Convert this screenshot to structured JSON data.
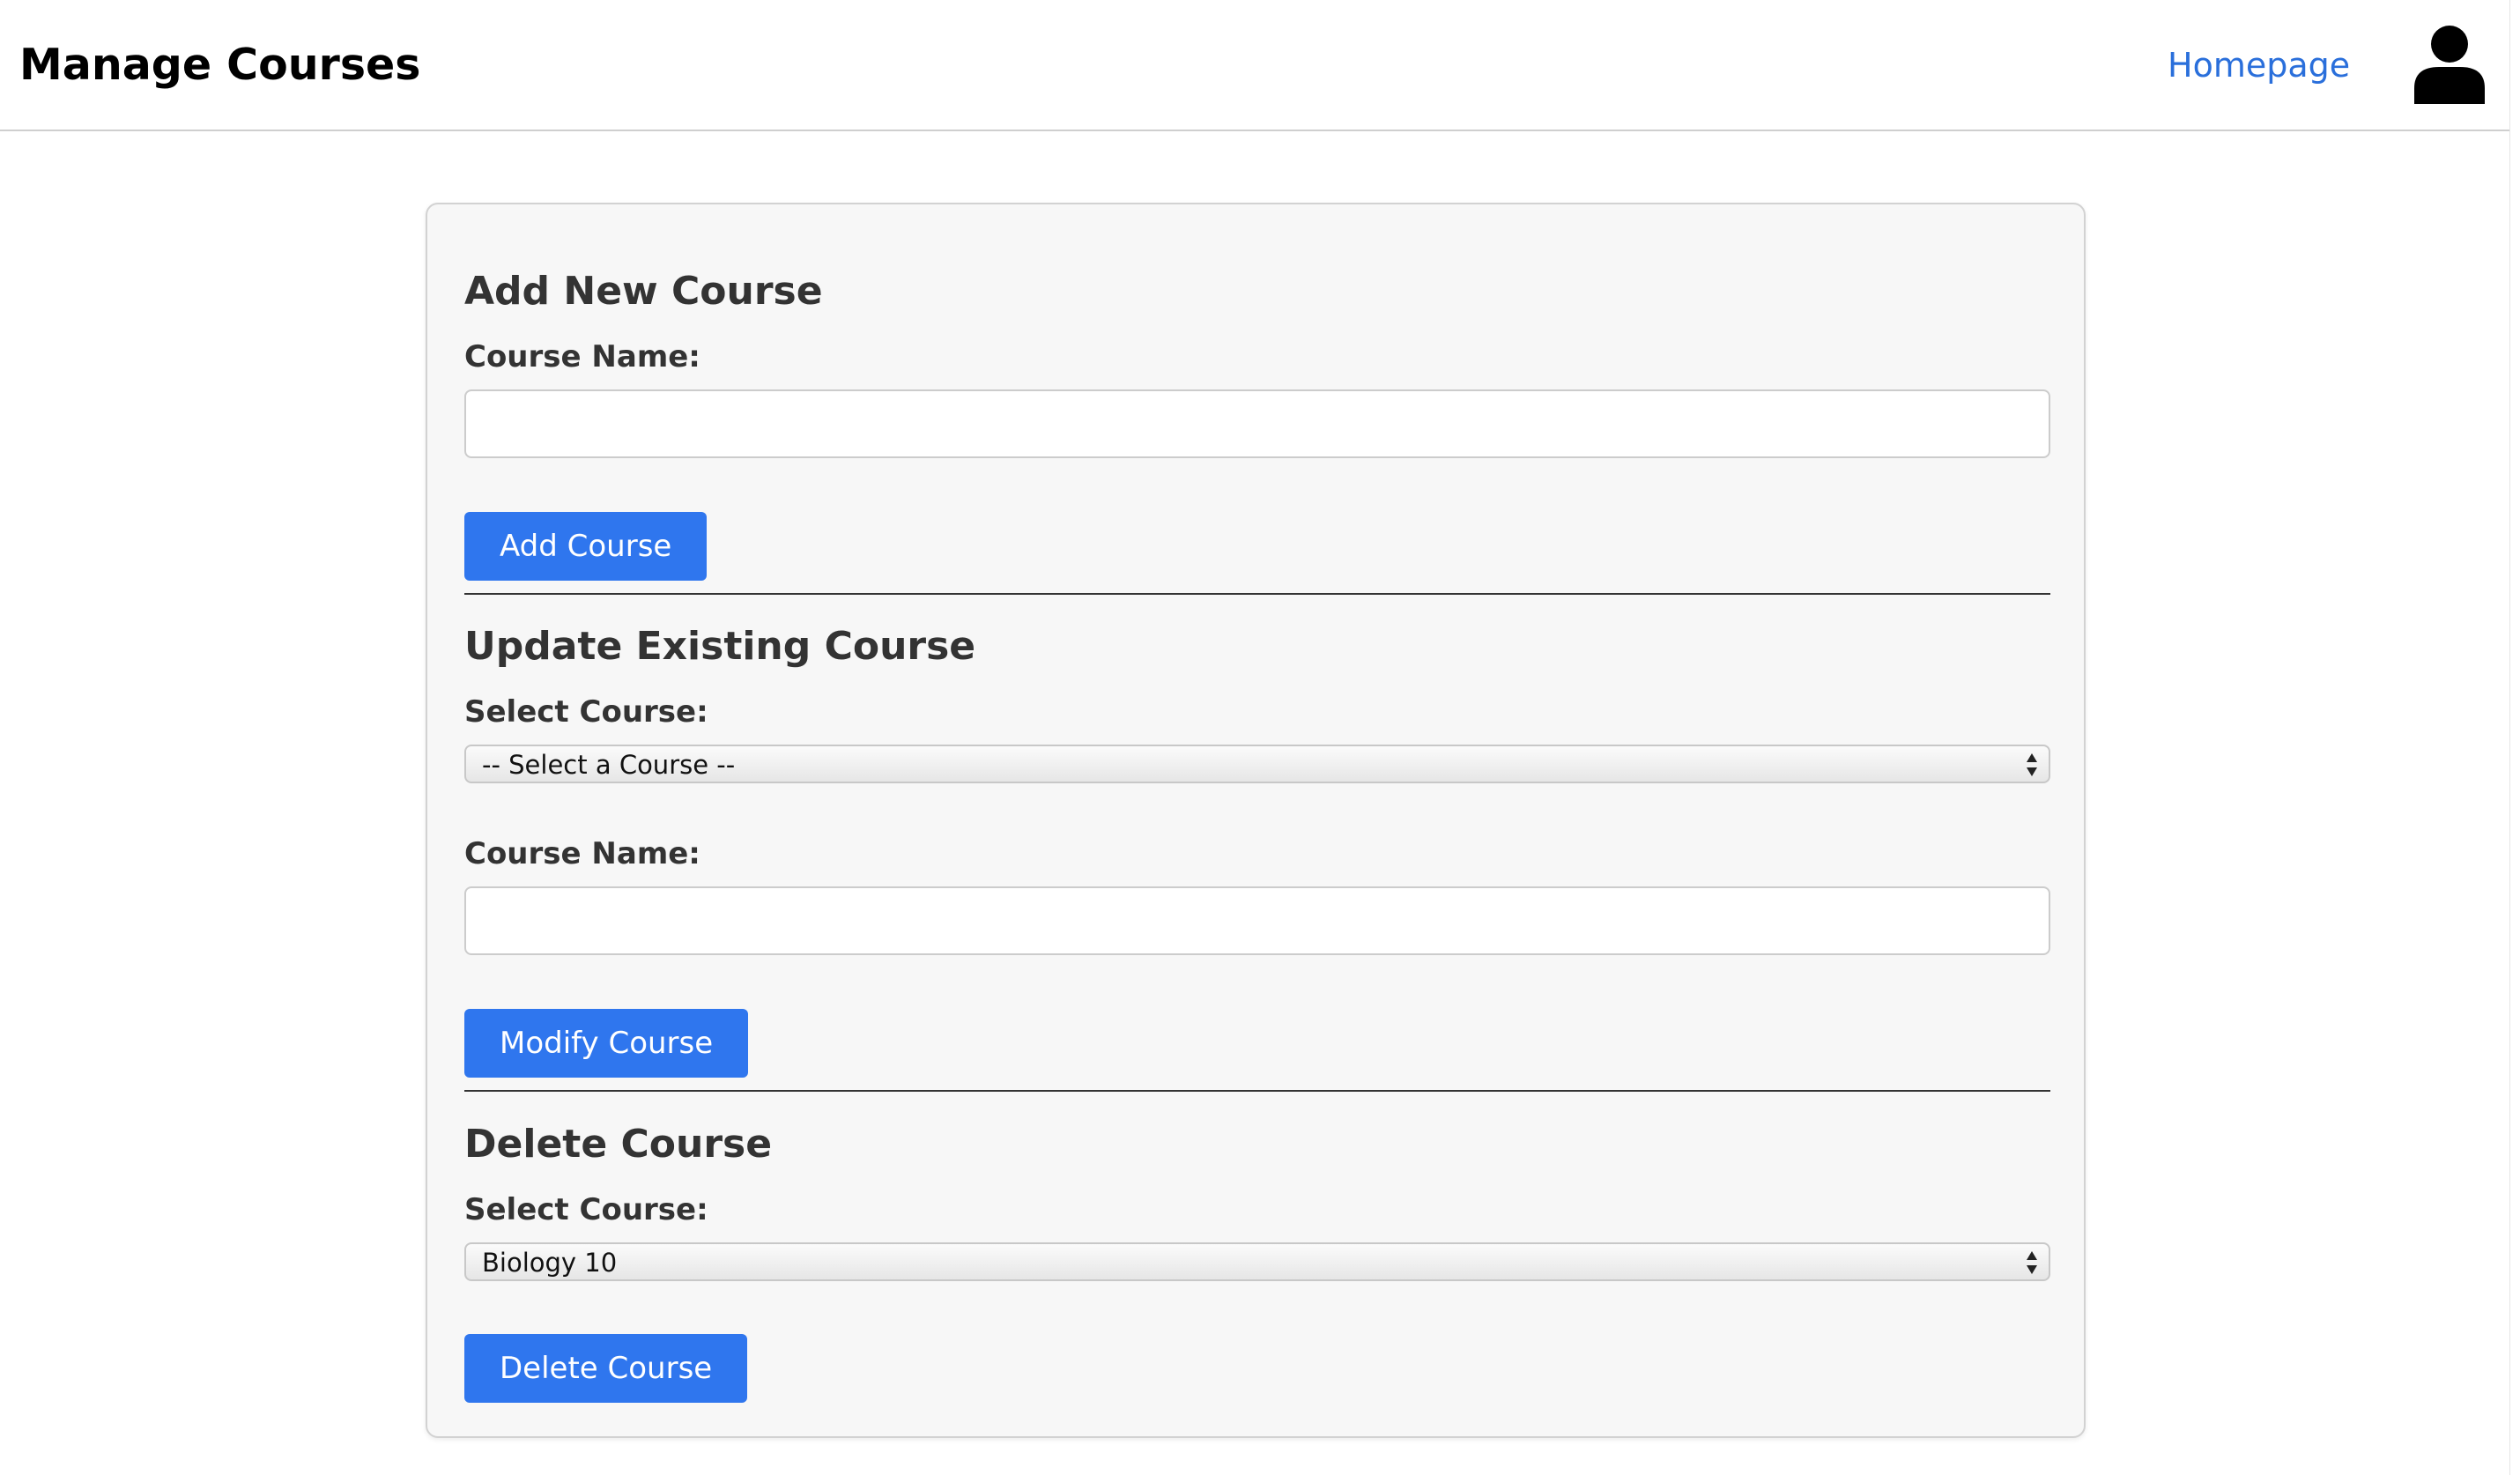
{
  "header": {
    "title": "Manage Courses",
    "nav_link": "Homepage",
    "avatar_icon": "user-icon"
  },
  "add_section": {
    "title": "Add New Course",
    "name_label": "Course Name:",
    "name_value": "",
    "button_label": "Add Course"
  },
  "update_section": {
    "title": "Update Existing Course",
    "select_label": "Select Course:",
    "select_value": "-- Select a Course --",
    "name_label": "Course Name:",
    "name_value": "",
    "button_label": "Modify Course"
  },
  "delete_section": {
    "title": "Delete Course",
    "select_label": "Select Course:",
    "select_value": "Biology 10",
    "button_label": "Delete Course"
  },
  "colors": {
    "accent": "#2f76ee",
    "link": "#2a6fdb",
    "card_bg": "#f7f7f7"
  }
}
